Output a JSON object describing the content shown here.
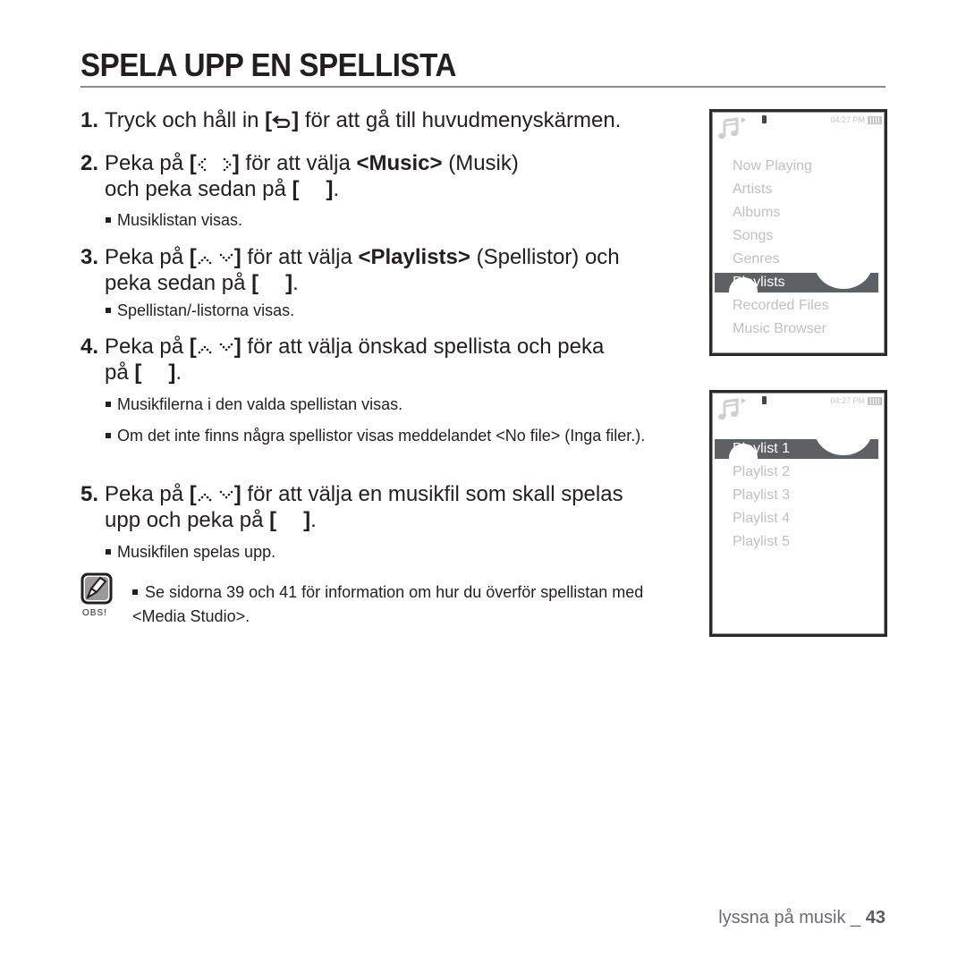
{
  "page": {
    "title": "SPELA UPP EN SPELLISTA",
    "steps": [
      {
        "num": "1.",
        "pre": "Tryck och håll in",
        "icon": "back-icon",
        "post": "för att gå till huvudmenyskärmen."
      },
      {
        "num": "2.",
        "pre": "Peka på",
        "icon": "left-right-icon",
        "mid": "för att välja",
        "bold": "<Music>",
        "post": "(Musik)",
        "line2_pre": "och peka sedan på",
        "line2_icon": "select-icon",
        "line2_post": ".",
        "bullets": [
          "Musiklistan visas."
        ]
      },
      {
        "num": "3.",
        "pre": "Peka på",
        "icon": "up-down-icon",
        "mid": "för att välja",
        "bold": "<Playlists>",
        "post": "(Spellistor) och",
        "line2_pre": "peka sedan på",
        "line2_icon": "select-icon",
        "line2_post": ".",
        "bullets": [
          "Spellistan/-listorna visas."
        ]
      },
      {
        "num": "4.",
        "pre": "Peka på",
        "icon": "up-down-icon",
        "post": "för att välja önskad spellista och peka",
        "line2_pre": "på",
        "line2_icon": "select-icon",
        "line2_post": ".",
        "bullets": [
          "Musikfilerna i den valda spellistan visas.",
          "Om det inte finns några spellistor visas meddelandet <No file> (Inga filer.)."
        ]
      },
      {
        "num": "5.",
        "pre": "Peka på",
        "icon": "up-down-icon",
        "post": "för att välja en musikfil som skall spelas",
        "line2_pre": "upp och peka på",
        "line2_icon": "select-icon",
        "line2_post": ".",
        "bullets": [
          "Musikfilen spelas upp."
        ]
      }
    ],
    "note": {
      "label": "OBS!",
      "text": "Se sidorna 39 och 41 för information om hur du överför spellistan med <Media Studio>."
    },
    "footer": {
      "section": "lyssna på musik _",
      "page_number": "43"
    }
  },
  "device_screens": [
    {
      "clock": "04:27 PM",
      "menu": [
        "Now Playing",
        "Artists",
        "Albums",
        "Songs",
        "Genres",
        "Playlists",
        "Recorded Files",
        "Music Browser"
      ],
      "selected_index": 5,
      "selected_visible_text": "ylists"
    },
    {
      "clock": "04:27 PM",
      "menu": [
        "Playlist 1",
        "Playlist 2",
        "Playlist 3",
        "Playlist 4",
        "Playlist 5"
      ],
      "selected_index": 0,
      "selected_visible_text": "ylist 1"
    }
  ],
  "colors": {
    "text": "#231f20",
    "menu_inactive": "#bfbfc5",
    "menu_highlight": "#5d6164",
    "footer": "#6a6a78"
  }
}
